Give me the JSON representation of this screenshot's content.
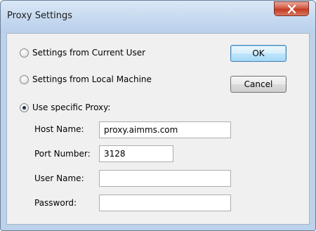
{
  "window": {
    "title": "Proxy Settings"
  },
  "options": {
    "current_user_label": "Settings from Current User",
    "local_machine_label": "Settings from Local Machine",
    "specific_proxy_label": "Use specific Proxy:",
    "selected": "specific_proxy"
  },
  "buttons": {
    "ok_label": "OK",
    "cancel_label": "Cancel"
  },
  "fields": {
    "host_name_label": "Host Name:",
    "host_name_value": "proxy.aimms.com",
    "port_number_label": "Port Number:",
    "port_number_value": "3128",
    "user_name_label": "User Name:",
    "user_name_value": "",
    "password_label": "Password:",
    "password_value": ""
  },
  "icons": {
    "close": "close-icon"
  },
  "colors": {
    "close_button": "#c23b22",
    "default_button_border": "#3c7fb1",
    "dialog_background": "#f0f0f0",
    "frame": "#bcd1ea"
  }
}
